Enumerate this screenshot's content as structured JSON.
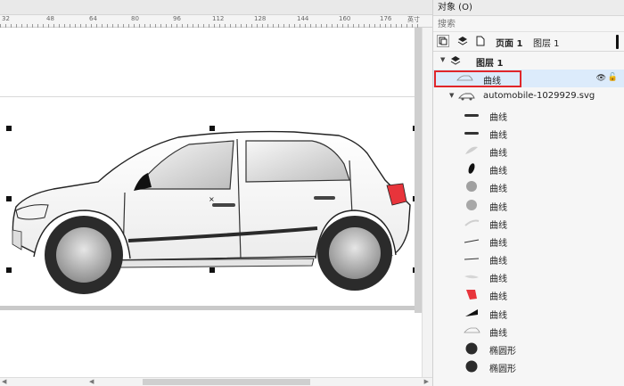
{
  "ruler": {
    "ticks": [
      "32",
      "48",
      "64",
      "80",
      "96",
      "112",
      "128",
      "144",
      "160",
      "176"
    ],
    "unit": "英寸"
  },
  "panel": {
    "title": "对象 (O)",
    "search_placeholder": "搜索",
    "page_label": "页面 1",
    "layer_tab_label": "图层 1"
  },
  "tree": {
    "layer": {
      "label": "图层 1"
    },
    "selected_curve": {
      "label": "曲线"
    },
    "group": {
      "label": "automobile-1029929.svg"
    },
    "children": [
      {
        "label": "曲线",
        "icon": "dark-bar-icon"
      },
      {
        "label": "曲线",
        "icon": "dark-bar-icon"
      },
      {
        "label": "曲线",
        "icon": "light-leaf-icon"
      },
      {
        "label": "曲线",
        "icon": "black-ellipse-icon"
      },
      {
        "label": "曲线",
        "icon": "grey-circle-icon"
      },
      {
        "label": "曲线",
        "icon": "grey-circle-icon"
      },
      {
        "label": "曲线",
        "icon": "light-arc-icon"
      },
      {
        "label": "曲线",
        "icon": "thin-line-icon"
      },
      {
        "label": "曲线",
        "icon": "thin-line-icon"
      },
      {
        "label": "曲线",
        "icon": "light-smear-icon"
      },
      {
        "label": "曲线",
        "icon": "red-taillight-icon"
      },
      {
        "label": "曲线",
        "icon": "black-wedge-icon"
      },
      {
        "label": "曲线",
        "icon": "car-outline-icon"
      },
      {
        "label": "椭圆形",
        "icon": "dark-circle-icon"
      },
      {
        "label": "椭圆形",
        "icon": "dark-circle-icon"
      }
    ]
  },
  "colors": {
    "selection_highlight": "#dcebfb",
    "annotation_red": "#e0262a",
    "taillight": "#e8343b"
  }
}
